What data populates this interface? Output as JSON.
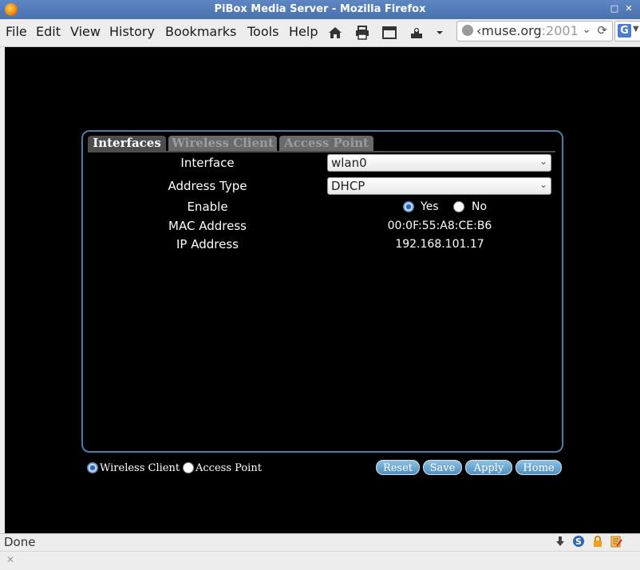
{
  "window": {
    "title": "PiBox Media Server - Mozilla Firefox"
  },
  "menubar": {
    "items": [
      "File",
      "Edit",
      "View",
      "History",
      "Bookmarks",
      "Tools",
      "Help"
    ]
  },
  "toolbar": {
    "icons": [
      "home-icon",
      "print-icon",
      "window-icon",
      "addon-icon",
      "dropdown-arrow-icon"
    ]
  },
  "urlbar": {
    "value_prefix": "‹muse.org",
    "value_suffix": ":2001"
  },
  "search": {
    "engine": "G"
  },
  "tabs": [
    "Interfaces",
    "Wireless Client",
    "Access Point"
  ],
  "form": {
    "interface": {
      "label": "Interface",
      "value": "wlan0"
    },
    "address_type": {
      "label": "Address Type",
      "value": "DHCP"
    },
    "enable": {
      "label": "Enable",
      "yes": "Yes",
      "no": "No",
      "selected": "Yes"
    },
    "mac": {
      "label": "MAC Address",
      "value": "00:0F:55:A8:CE:B6"
    },
    "ip": {
      "label": "IP Address",
      "value": "192.168.101.17"
    }
  },
  "mode": {
    "wireless_client": "Wireless Client",
    "access_point": "Access Point",
    "selected": "Wireless Client"
  },
  "buttons": {
    "reset": "Reset",
    "save": "Save",
    "apply": "Apply",
    "home": "Home"
  },
  "status": {
    "text": "Done"
  },
  "colors": {
    "accent": "#4a7ea8",
    "button": "#5d9cc9",
    "titlebar": "#4f78b4"
  }
}
